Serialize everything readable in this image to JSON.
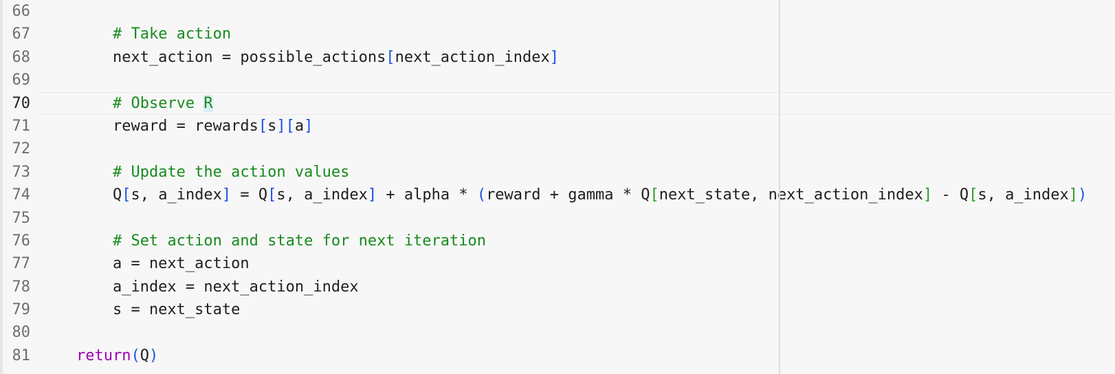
{
  "editor": {
    "lines": [
      {
        "number": "66",
        "current": false,
        "tokens": []
      },
      {
        "number": "67",
        "current": false,
        "tokens": [
          {
            "text": "        ",
            "type": "plain"
          },
          {
            "text": "# Take action",
            "type": "comment"
          }
        ]
      },
      {
        "number": "68",
        "current": false,
        "tokens": [
          {
            "text": "        next_action = possible_actions",
            "type": "plain"
          },
          {
            "text": "[",
            "type": "b1"
          },
          {
            "text": "next_action_index",
            "type": "plain"
          },
          {
            "text": "]",
            "type": "b1"
          }
        ]
      },
      {
        "number": "69",
        "current": false,
        "tokens": []
      },
      {
        "number": "70",
        "current": true,
        "tokens": [
          {
            "text": "        ",
            "type": "plain"
          },
          {
            "text": "# Observe ",
            "type": "comment"
          },
          {
            "text": "R",
            "type": "comment-sel"
          }
        ]
      },
      {
        "number": "71",
        "current": false,
        "tokens": [
          {
            "text": "        reward = rewards",
            "type": "plain"
          },
          {
            "text": "[",
            "type": "b1"
          },
          {
            "text": "s",
            "type": "plain"
          },
          {
            "text": "][",
            "type": "b1"
          },
          {
            "text": "a",
            "type": "plain"
          },
          {
            "text": "]",
            "type": "b1"
          }
        ]
      },
      {
        "number": "72",
        "current": false,
        "tokens": []
      },
      {
        "number": "73",
        "current": false,
        "tokens": [
          {
            "text": "        ",
            "type": "plain"
          },
          {
            "text": "# Update the action values",
            "type": "comment"
          }
        ]
      },
      {
        "number": "74",
        "current": false,
        "tokens": [
          {
            "text": "        Q",
            "type": "plain"
          },
          {
            "text": "[",
            "type": "b1"
          },
          {
            "text": "s, a_index",
            "type": "plain"
          },
          {
            "text": "]",
            "type": "b1"
          },
          {
            "text": " = Q",
            "type": "plain"
          },
          {
            "text": "[",
            "type": "b1"
          },
          {
            "text": "s, a_index",
            "type": "plain"
          },
          {
            "text": "]",
            "type": "b1"
          },
          {
            "text": " + alpha * ",
            "type": "plain"
          },
          {
            "text": "(",
            "type": "b1"
          },
          {
            "text": "reward + gamma * Q",
            "type": "plain"
          },
          {
            "text": "[",
            "type": "b2"
          },
          {
            "text": "next_state, next_action_index",
            "type": "plain"
          },
          {
            "text": "]",
            "type": "b2"
          },
          {
            "text": " - Q",
            "type": "plain"
          },
          {
            "text": "[",
            "type": "b2"
          },
          {
            "text": "s, a_index",
            "type": "plain"
          },
          {
            "text": "]",
            "type": "b2"
          },
          {
            "text": ")",
            "type": "b1"
          }
        ]
      },
      {
        "number": "75",
        "current": false,
        "tokens": []
      },
      {
        "number": "76",
        "current": false,
        "tokens": [
          {
            "text": "        ",
            "type": "plain"
          },
          {
            "text": "# Set action and state for next iteration",
            "type": "comment"
          }
        ]
      },
      {
        "number": "77",
        "current": false,
        "tokens": [
          {
            "text": "        a = next_action",
            "type": "plain"
          }
        ]
      },
      {
        "number": "78",
        "current": false,
        "tokens": [
          {
            "text": "        a_index = next_action_index",
            "type": "plain"
          }
        ]
      },
      {
        "number": "79",
        "current": false,
        "tokens": [
          {
            "text": "        s = next_state",
            "type": "plain"
          }
        ]
      },
      {
        "number": "80",
        "current": false,
        "tokens": []
      },
      {
        "number": "81",
        "current": false,
        "tokens": [
          {
            "text": "    ",
            "type": "plain"
          },
          {
            "text": "return",
            "type": "keyword"
          },
          {
            "text": "(",
            "type": "b1"
          },
          {
            "text": "Q",
            "type": "plain"
          },
          {
            "text": ")",
            "type": "b1"
          }
        ]
      }
    ]
  },
  "colors": {
    "background": "#f7f7f7",
    "comment": "#198a1e",
    "keyword": "#a000b4",
    "bracket_level1": "#1c50e8",
    "bracket_level2": "#2d9a2d",
    "line_number": "#6e6e6e",
    "selection": "#d9eef2"
  }
}
